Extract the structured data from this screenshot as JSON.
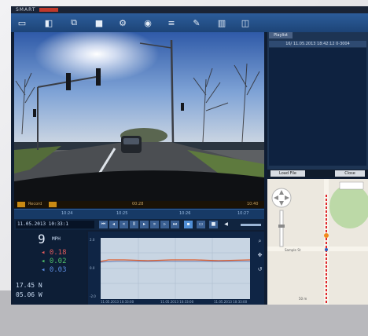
{
  "title": {
    "app_name": "SMART"
  },
  "toolbar": {
    "icons": [
      "open-folder-icon",
      "camera-icon",
      "network-icon",
      "save-icon",
      "settings-icon",
      "map-pin-icon",
      "list-icon",
      "tool-icon",
      "split-view-icon",
      "help-icon"
    ]
  },
  "playlist": {
    "tab_label": "Playlist",
    "file_entry": "16/ 11.05.2013 18:42:12 0-3004"
  },
  "side_buttons": {
    "left_label": "Load File",
    "right_label": "Close"
  },
  "video_status": {
    "left_label": "Record",
    "time_label": "00:28",
    "right_label": "10:40"
  },
  "timeline": {
    "labels": [
      "10:24",
      "10:25",
      "10:26",
      "10:27"
    ]
  },
  "playback": {
    "timestamp": "11.05.2013  10:33:1",
    "buttons": [
      "skip-start-icon",
      "prev-frame-icon",
      "rewind-icon",
      "pause-icon",
      "play-icon",
      "forward-icon",
      "next-frame-icon",
      "skip-end-icon",
      "fullscreen-icon",
      "snapshot-icon",
      "stop-icon",
      "volume-icon"
    ]
  },
  "gauges": {
    "speed": "9",
    "speed_unit": "MPH",
    "gx": "0.18",
    "gy": "0.02",
    "gz": "0.03",
    "lat": "17.45 N",
    "lon": "05.06 W"
  },
  "graph": {
    "y_labels": [
      "2.0",
      "0.0",
      "-2.0"
    ],
    "x_labels": [
      "11.05.2013 10:33:00",
      "11.05.2013 10:33:00",
      "11.05.2013 10:33:00"
    ],
    "side_icons": [
      "zoom-icon",
      "pan-icon",
      "reset-icon"
    ]
  },
  "map": {
    "street_label": "Sample St",
    "scale_label": "50 m"
  },
  "colors": {
    "accent": "#2c5d9b",
    "graph_line": "#e05c2a",
    "track": "#e0262b"
  }
}
